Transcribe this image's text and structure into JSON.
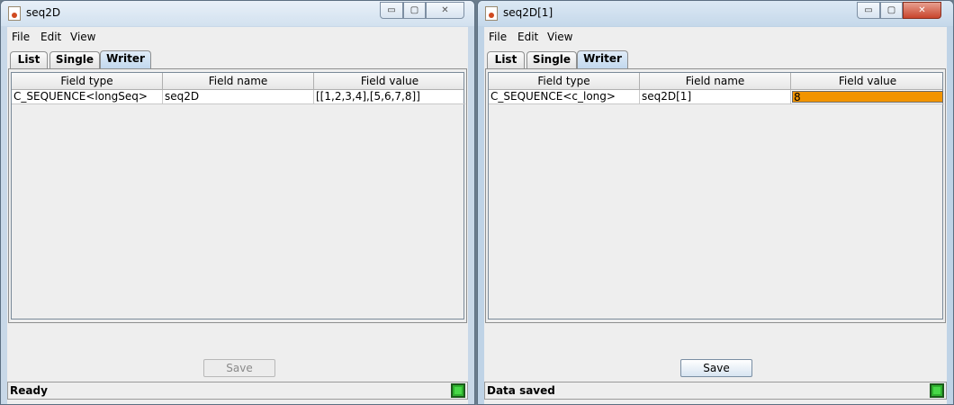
{
  "windows": [
    {
      "title": "seq2D",
      "menu": [
        "File",
        "Edit",
        "View"
      ],
      "tabs": [
        "List",
        "Single",
        "Writer"
      ],
      "active_tab": "Writer",
      "columns": [
        "Field type",
        "Field name",
        "Field value"
      ],
      "row": {
        "field_type": "C_SEQUENCE<longSeq>",
        "field_name": "seq2D",
        "field_value": "[[1,2,3,4],[5,6,7,8]]"
      },
      "save_label": "Save",
      "save_enabled": false,
      "status": "Ready"
    },
    {
      "title": "seq2D[1]",
      "menu": [
        "File",
        "Edit",
        "View"
      ],
      "tabs": [
        "List",
        "Single",
        "Writer"
      ],
      "active_tab": "Writer",
      "columns": [
        "Field type",
        "Field name",
        "Field value"
      ],
      "row": {
        "field_type": "C_SEQUENCE<c_long>",
        "field_name": "seq2D[1]",
        "field_value": "8"
      },
      "save_label": "Save",
      "save_enabled": true,
      "status": "Data saved"
    }
  ],
  "window_buttons": {
    "minimize": "▭",
    "maximize": "▢",
    "close": "✕"
  },
  "colors": {
    "editing_cell": "#f29400",
    "status_led": "#2fb02f"
  }
}
